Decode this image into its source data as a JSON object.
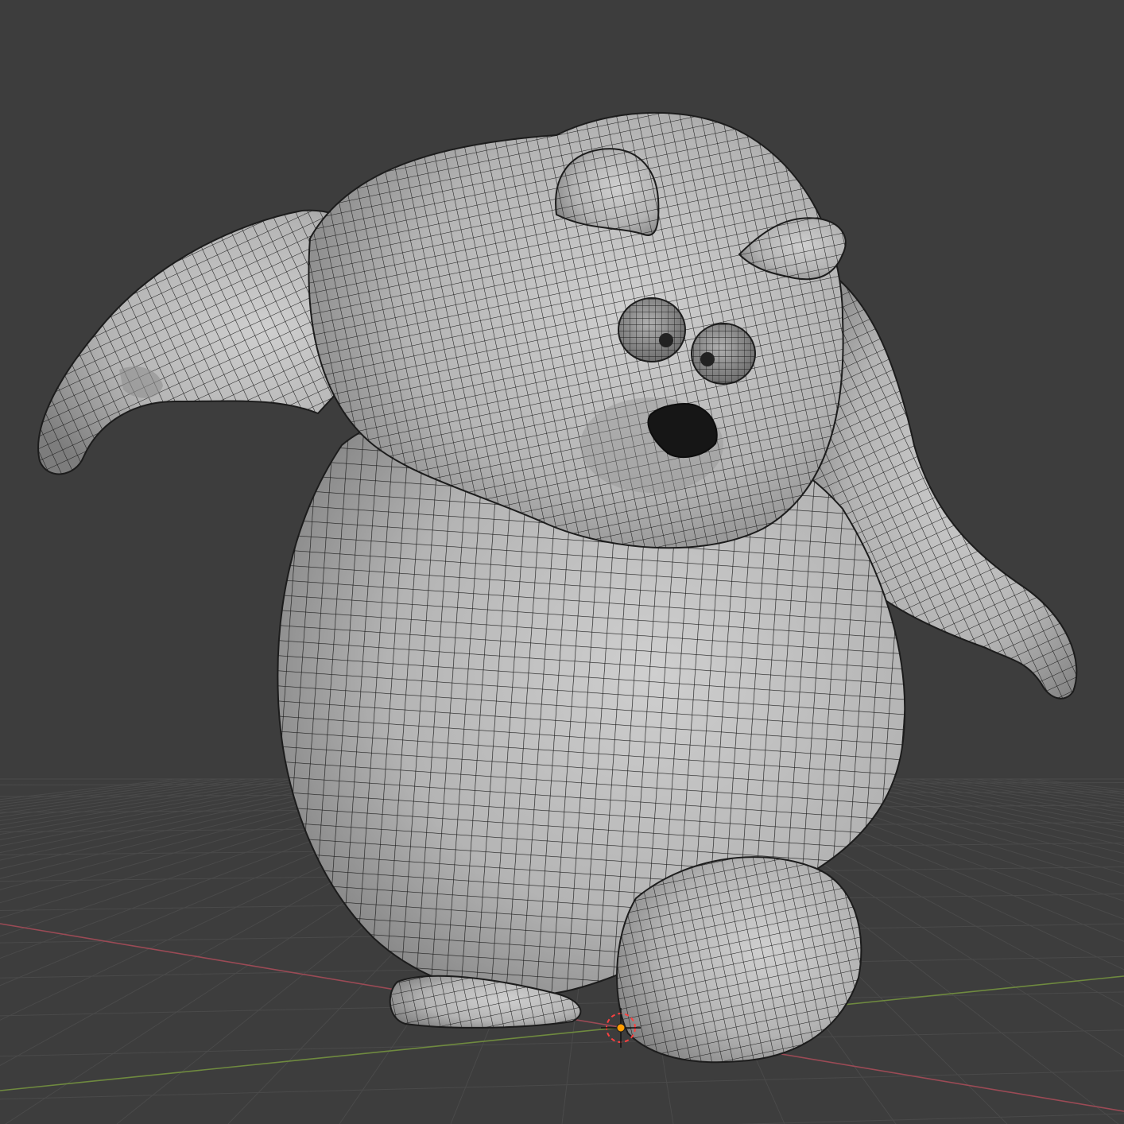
{
  "viewport": {
    "kind": "3d-viewport",
    "shading": "solid",
    "overlay": "wireframe",
    "object": "bear-mesh"
  },
  "colors": {
    "background": "#3d3d3d",
    "grid_line": "#4a4a4a",
    "x_axis": "#9b4a55",
    "y_axis": "#6f8a3f",
    "mesh_fill": "#b9b9b9",
    "mesh_shadow": "#8c8c8c",
    "wire": "#1c1c1c",
    "nose": "#161616",
    "origin_point": "#ff9c00",
    "cursor_ring": "#ff4040"
  },
  "icons": {
    "origin": "object-origin-icon",
    "cursor": "3d-cursor-icon"
  }
}
